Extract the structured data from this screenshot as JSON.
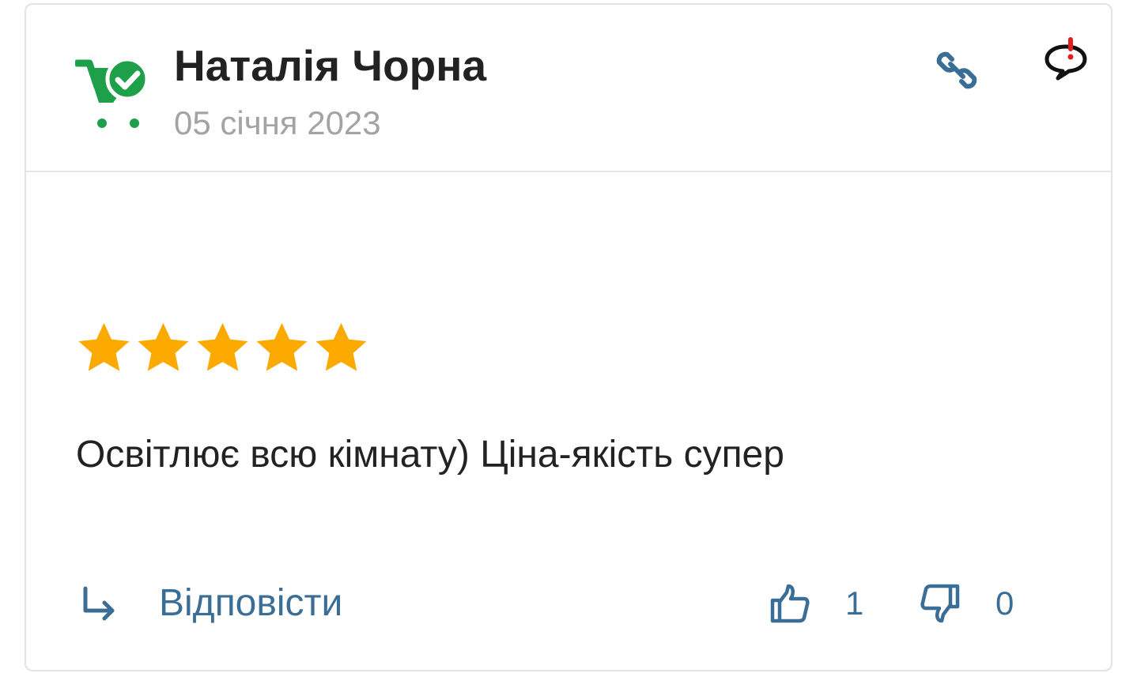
{
  "review": {
    "author": "Наталія Чорна",
    "date": "05 січня 2023",
    "rating": 5,
    "rating_max": 5,
    "text": "Освітлює всю кімнату) Ціна-якість супер"
  },
  "actions": {
    "reply_label": "Відповісти",
    "likes": "1",
    "dislikes": "0"
  },
  "icons": {
    "badge": "verified-buyer-cart-icon",
    "link": "link-icon",
    "report": "report-comment-icon",
    "reply": "reply-arrow-icon",
    "like": "thumbs-up-icon",
    "dislike": "thumbs-down-icon",
    "star": "star-icon"
  },
  "colors": {
    "badge_green": "#1ea04a",
    "star": "#fcaa00",
    "accent_blue": "#3b6e96",
    "report_red": "#e02020",
    "text": "#222222",
    "muted": "#a3a3a3"
  }
}
